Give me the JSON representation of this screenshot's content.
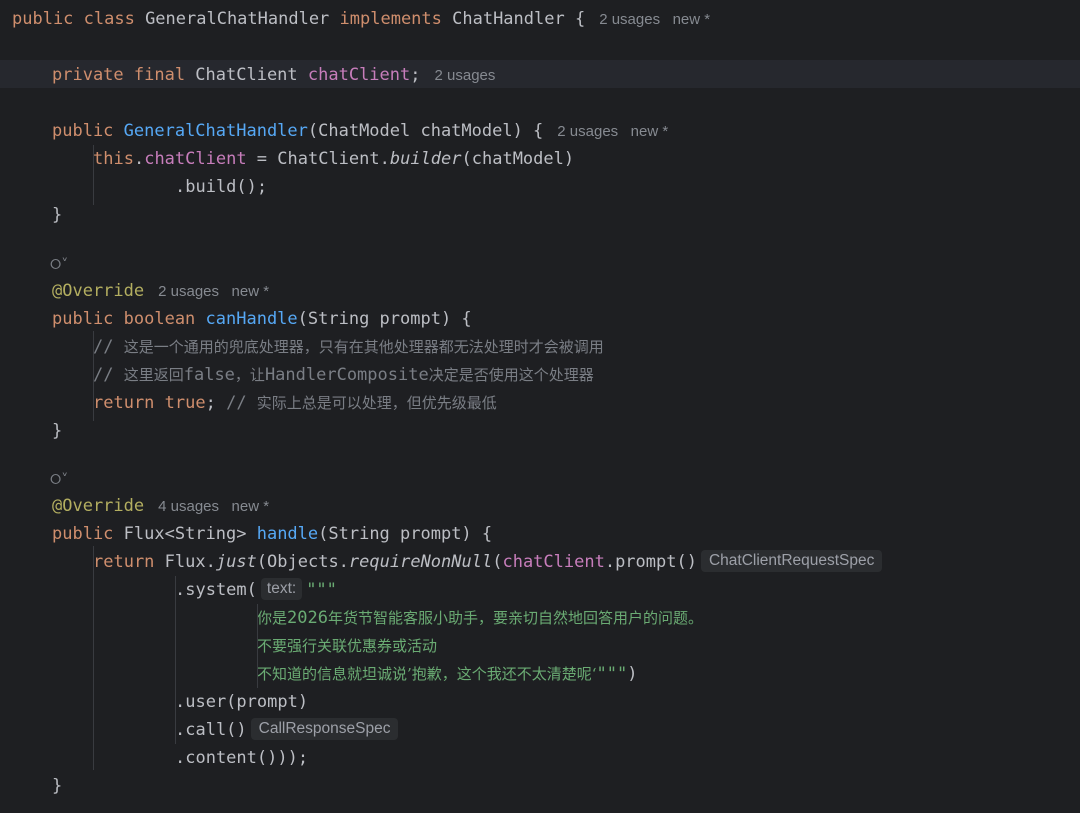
{
  "editor": {
    "lines": [
      {
        "id": "class-decl",
        "tokens": [
          [
            "kw",
            "public class "
          ],
          [
            "pl",
            "GeneralChatHandler "
          ],
          [
            "kw",
            "implements "
          ],
          [
            "pl",
            "ChatHandler {"
          ]
        ],
        "hint": "2 usages   new *"
      },
      {
        "id": "field-decl",
        "tokens": [
          [
            "kw",
            "private final "
          ],
          [
            "pl",
            "ChatClient "
          ],
          [
            "field",
            "chatClient"
          ],
          [
            "pl",
            ";"
          ]
        ],
        "hint": "2 usages"
      },
      {
        "id": "ctor-decl",
        "tokens": [
          [
            "kw",
            "public "
          ],
          [
            "fn",
            "GeneralChatHandler"
          ],
          [
            "pl",
            "(ChatModel chatModel) {"
          ]
        ],
        "hint": "2 usages   new *"
      },
      {
        "id": "ctor-body-1",
        "tokens": [
          [
            "kw",
            "this"
          ],
          [
            "pl",
            "."
          ],
          [
            "field",
            "chatClient"
          ],
          [
            "pl",
            " = ChatClient."
          ],
          [
            "ital",
            "builder"
          ],
          [
            "pl",
            "(chatModel)"
          ]
        ]
      },
      {
        "id": "ctor-body-2",
        "tokens": [
          [
            "pl",
            ".build();"
          ]
        ]
      },
      {
        "id": "ctor-close",
        "tokens": [
          [
            "pl",
            "}"
          ]
        ]
      },
      {
        "id": "override-1",
        "tokens": [
          [
            "ann",
            "@Override"
          ]
        ],
        "hint": "2 usages   new *"
      },
      {
        "id": "canhandle-decl",
        "tokens": [
          [
            "kw",
            "public boolean "
          ],
          [
            "fn",
            "canHandle"
          ],
          [
            "pl",
            "(String prompt) {"
          ]
        ]
      },
      {
        "id": "comment-1",
        "tokens": [
          [
            "cmt",
            "// "
          ],
          [
            "cmtcjk",
            "这是一个通用的兜底处理器，只有在其他处理器都无法处理时才会被调用"
          ]
        ]
      },
      {
        "id": "comment-2",
        "tokens": [
          [
            "cmt",
            "// "
          ],
          [
            "cmtcjk",
            "这里返回"
          ],
          [
            "cmt",
            "false"
          ],
          [
            "cmtcjk",
            "，让"
          ],
          [
            "cmt",
            "HandlerComposite"
          ],
          [
            "cmtcjk",
            "决定是否使用这个处理器"
          ]
        ]
      },
      {
        "id": "return-true",
        "tokens": [
          [
            "kw",
            "return true"
          ],
          [
            "pl",
            "; "
          ],
          [
            "cmt",
            "// "
          ],
          [
            "cmtcjk",
            "实际上总是可以处理，但优先级最低"
          ]
        ]
      },
      {
        "id": "canhandle-close",
        "tokens": [
          [
            "pl",
            "}"
          ]
        ]
      },
      {
        "id": "override-2",
        "tokens": [
          [
            "ann",
            "@Override"
          ]
        ],
        "hint": "4 usages   new *"
      },
      {
        "id": "handle-decl",
        "tokens": [
          [
            "kw",
            "public "
          ],
          [
            "pl",
            "Flux<String> "
          ],
          [
            "fn",
            "handle"
          ],
          [
            "pl",
            "(String prompt) {"
          ]
        ]
      },
      {
        "id": "return-flux",
        "tokens": [
          [
            "kw",
            "return "
          ],
          [
            "pl",
            "Flux."
          ],
          [
            "ital",
            "just"
          ],
          [
            "pl",
            "(Objects."
          ],
          [
            "ital",
            "requireNonNull"
          ],
          [
            "pl",
            "("
          ],
          [
            "field",
            "chatClient"
          ],
          [
            "pl",
            ".prompt()"
          ]
        ],
        "inlay": "ChatClientRequestSpec"
      },
      {
        "id": "system-call",
        "tokens": [
          [
            "pl",
            ".system("
          ],
          [
            "param",
            "text:"
          ],
          [
            "str",
            "\"\"\""
          ]
        ]
      },
      {
        "id": "str-line-1",
        "tokens": [
          [
            "strcjk",
            "你是"
          ],
          [
            "str",
            "2026"
          ],
          [
            "strcjk",
            "年货节智能客服小助手，要亲切自然地回答用户的问题。"
          ]
        ]
      },
      {
        "id": "str-line-2",
        "tokens": [
          [
            "strcjk",
            "不要强行关联优惠券或活动"
          ]
        ]
      },
      {
        "id": "str-line-3",
        "tokens": [
          [
            "strcjk",
            "不知道的信息就坦诚说’抱歉，这个我还不太清楚呢‘"
          ],
          [
            "str",
            "\"\"\""
          ],
          [
            "pl",
            ")"
          ]
        ]
      },
      {
        "id": "user-call",
        "tokens": [
          [
            "pl",
            ".user(prompt)"
          ]
        ]
      },
      {
        "id": "call-call",
        "tokens": [
          [
            "pl",
            ".call()"
          ]
        ],
        "inlay": "CallResponseSpec"
      },
      {
        "id": "content-call",
        "tokens": [
          [
            "pl",
            ".content()));"
          ]
        ]
      },
      {
        "id": "handle-close",
        "tokens": [
          [
            "pl",
            "}"
          ]
        ]
      }
    ],
    "gutter_icons": [
      "implements-icon",
      "implements-icon"
    ]
  }
}
